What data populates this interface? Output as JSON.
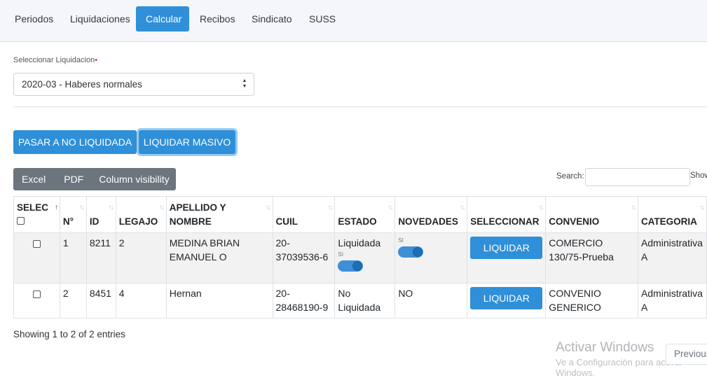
{
  "nav": {
    "items": [
      {
        "label": "Periodos"
      },
      {
        "label": "Liquidaciones"
      },
      {
        "label": "Calcular"
      },
      {
        "label": "Recibos"
      },
      {
        "label": "Sindicato"
      },
      {
        "label": "SUSS"
      }
    ],
    "active": "Calcular"
  },
  "form": {
    "label": "Seleccionar Liquidacion",
    "required_mark": "•",
    "selected_value": "2020-03 - Haberes normales"
  },
  "actions": {
    "pasar_label": "PASAR A NO LIQUIDADA",
    "liquidar_masivo_label": "LIQUIDAR MASIVO"
  },
  "datatable": {
    "buttons": {
      "excel": "Excel",
      "pdf": "PDF",
      "colvis": "Column visibility"
    },
    "search_label": "Search:",
    "search_value": "",
    "show_label": "Show",
    "info": "Showing 1 to 2 of 2 entries",
    "previous_label": "Previous"
  },
  "table": {
    "headers": {
      "selec": "SELEC",
      "num": "N°",
      "id": "ID",
      "legajo": "LEGAJO",
      "nombre": "APELLIDO Y NOMBRE",
      "cuil": "CUIL",
      "estado": "ESTADO",
      "novedades": "NOVEDADES",
      "seleccionar": "SELECCIONAR",
      "convenio": "CONVENIO",
      "categoria": "CATEGORIA"
    },
    "rows": [
      {
        "num": "1",
        "id": "8211",
        "legajo": "2",
        "nombre": "MEDINA BRIAN EMANUEL O",
        "cuil": "20-37039536-6",
        "estado": "Liquidada",
        "estado_toggle_label": "SI",
        "novedades_toggle_label": "SI",
        "button": "LIQUIDAR",
        "convenio": "COMERCIO 130/75-Prueba",
        "categoria": "Administrativa A"
      },
      {
        "num": "2",
        "id": "8451",
        "legajo": "4",
        "nombre": "Hernan",
        "cuil": "20-28468190-9",
        "estado": "No Liquidada",
        "novedades": "NO",
        "button": "LIQUIDAR",
        "convenio": "CONVENIO GENERICO",
        "categoria": "Administrativa A"
      }
    ]
  },
  "watermark": {
    "title": "Activar Windows",
    "subtitle": "Ve a Configuración para activar Windows."
  },
  "colors": {
    "primary": "#2f8fd8",
    "secondary": "#6c757d"
  }
}
